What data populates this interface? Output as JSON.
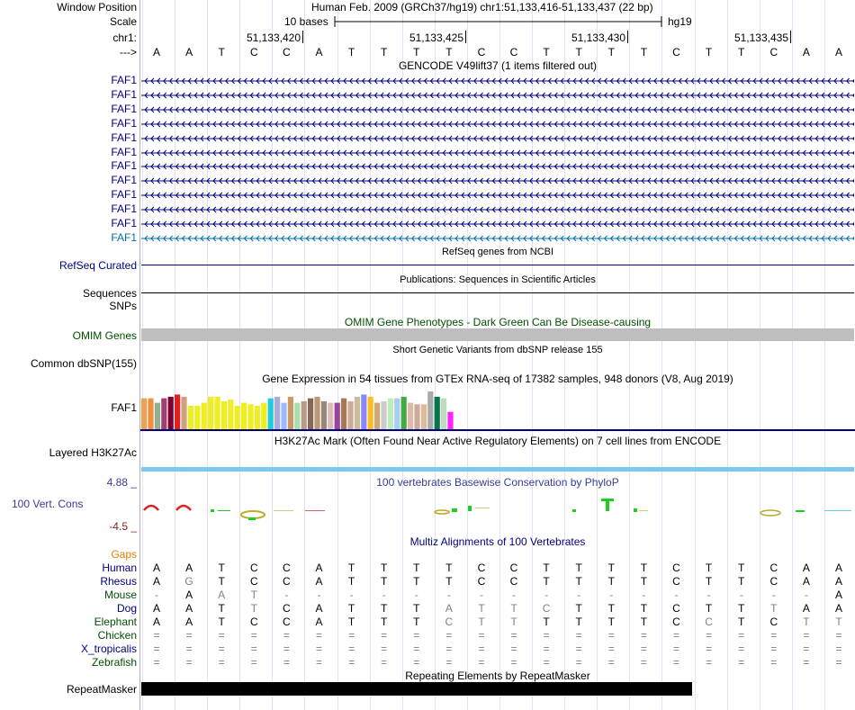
{
  "header": {
    "window_position_label": "Window Position",
    "window_position_value": "Human Feb. 2009 (GRCh37/hg19)   chr1:51,133,416-51,133,437 (22 bp)",
    "scale_label": "Scale",
    "scale_text": "10 bases",
    "assembly": "hg19",
    "chrom_label": "chr1:",
    "coord_labels": [
      "51,133,420",
      "51,133,425",
      "51,133,430",
      "51,133,435"
    ],
    "strand_label": "--->",
    "bases": [
      "A",
      "A",
      "T",
      "C",
      "C",
      "A",
      "T",
      "T",
      "T",
      "T",
      "C",
      "C",
      "T",
      "T",
      "T",
      "T",
      "C",
      "T",
      "T",
      "C",
      "A",
      "A"
    ]
  },
  "gencode": {
    "title": "GENCODE V49lift37 (1 items filtered out)",
    "genes": [
      "FAF1",
      "FAF1",
      "FAF1",
      "FAF1",
      "FAF1",
      "FAF1",
      "FAF1",
      "FAF1",
      "FAF1",
      "FAF1",
      "FAF1",
      "FAF1"
    ]
  },
  "refseq": {
    "title": "RefSeq genes from NCBI",
    "label": "RefSeq Curated"
  },
  "publications": {
    "title": "Publications: Sequences in Scientific Articles",
    "label": "Sequences"
  },
  "snps": {
    "label": "SNPs"
  },
  "omim": {
    "title": "OMIM Gene Phenotypes - Dark Green Can Be Disease-causing",
    "label": "OMIM Genes"
  },
  "dbsnp": {
    "title": "Short Genetic Variants from dbSNP release 155",
    "label": "Common dbSNP(155)"
  },
  "gtex": {
    "title": "Gene Expression in 54 tissues from GTEx RNA-seq of 17382 samples, 948 donors (V8, Aug 2019)",
    "label": "FAF1",
    "bars": [
      {
        "v": 0.82,
        "c": "#f0a050"
      },
      {
        "v": 0.82,
        "c": "#f09040"
      },
      {
        "v": 0.7,
        "c": "#90b090"
      },
      {
        "v": 0.82,
        "c": "#a04070"
      },
      {
        "v": 0.86,
        "c": "#800030"
      },
      {
        "v": 0.92,
        "c": "#e02020"
      },
      {
        "v": 0.86,
        "c": "#d0a080"
      },
      {
        "v": 0.62,
        "c": "#eeee22"
      },
      {
        "v": 0.62,
        "c": "#eeee22"
      },
      {
        "v": 0.7,
        "c": "#eeee22"
      },
      {
        "v": 0.86,
        "c": "#eeee22"
      },
      {
        "v": 0.86,
        "c": "#eeee22"
      },
      {
        "v": 0.74,
        "c": "#eeee22"
      },
      {
        "v": 0.78,
        "c": "#eeee22"
      },
      {
        "v": 0.62,
        "c": "#eeee22"
      },
      {
        "v": 0.7,
        "c": "#eeee22"
      },
      {
        "v": 0.66,
        "c": "#eeee22"
      },
      {
        "v": 0.62,
        "c": "#eeee22"
      },
      {
        "v": 0.7,
        "c": "#eeee22"
      },
      {
        "v": 0.82,
        "c": "#22ccdd"
      },
      {
        "v": 0.86,
        "c": "#aaaadd"
      },
      {
        "v": 0.7,
        "c": "#99bbff"
      },
      {
        "v": 0.86,
        "c": "#cc9966"
      },
      {
        "v": 0.7,
        "c": "#aaddaa"
      },
      {
        "v": 0.74,
        "c": "#bb9988"
      },
      {
        "v": 0.82,
        "c": "#886655"
      },
      {
        "v": 0.86,
        "c": "#bb9977"
      },
      {
        "v": 0.74,
        "c": "#998877"
      },
      {
        "v": 0.7,
        "c": "#ddbbbb"
      },
      {
        "v": 0.7,
        "c": "#994499"
      },
      {
        "v": 0.82,
        "c": "#aa7755"
      },
      {
        "v": 0.74,
        "c": "#ccaa99"
      },
      {
        "v": 0.86,
        "c": "#ccbb99"
      },
      {
        "v": 0.92,
        "c": "#8888ff"
      },
      {
        "v": 0.86,
        "c": "#ffbb22"
      },
      {
        "v": 0.7,
        "c": "#ccaa77"
      },
      {
        "v": 0.74,
        "c": "#cccccc"
      },
      {
        "v": 0.82,
        "c": "#bbeebb"
      },
      {
        "v": 0.82,
        "c": "#aaccee"
      },
      {
        "v": 0.86,
        "c": "#44aa44"
      },
      {
        "v": 0.7,
        "c": "#ddbbaa"
      },
      {
        "v": 0.66,
        "c": "#ccaa99"
      },
      {
        "v": 0.66,
        "c": "#ddbb99"
      },
      {
        "v": 1.0,
        "c": "#aaaaaa"
      },
      {
        "v": 0.86,
        "c": "#007744"
      },
      {
        "v": 0.82,
        "c": "#bbddbb"
      },
      {
        "v": 0.46,
        "c": "#ff22ff"
      }
    ]
  },
  "h3k27ac": {
    "title": "H3K27Ac Mark (Often Found Near Active Regulatory Elements) on 7 cell lines from ENCODE",
    "label": "Layered H3K27Ac"
  },
  "conservation": {
    "title": "100 vertebrates Basewise Conservation by PhyloP",
    "label": "100 Vert. Cons",
    "ymax_label": "4.88 _",
    "ymin_label": "-4.5 _"
  },
  "multiz": {
    "title": "Multiz Alignments of 100 Vertebrates",
    "gaps_label": "Gaps",
    "species": [
      {
        "name": "Human",
        "color": "#000080",
        "seq": [
          "A",
          "A",
          "T",
          "C",
          "C",
          "A",
          "T",
          "T",
          "T",
          "T",
          "C",
          "C",
          "T",
          "T",
          "T",
          "T",
          "C",
          "T",
          "T",
          "C",
          "A",
          "A"
        ]
      },
      {
        "name": "Rhesus",
        "color": "#000080",
        "seq": [
          "A",
          "G",
          "T",
          "C",
          "C",
          "A",
          "T",
          "T",
          "T",
          "T",
          "C",
          "C",
          "T",
          "T",
          "T",
          "T",
          "C",
          "T",
          "T",
          "C",
          "A",
          "A"
        ]
      },
      {
        "name": "Mouse",
        "color": "#005000",
        "seq": [
          "-",
          "A",
          "A",
          "T",
          "-",
          "-",
          "-",
          "-",
          "-",
          "-",
          "-",
          "-",
          "-",
          "-",
          "-",
          "-",
          "-",
          "-",
          "-",
          "-",
          "-",
          "A"
        ]
      },
      {
        "name": "Dog",
        "color": "#000080",
        "seq": [
          "A",
          "A",
          "T",
          "T",
          "C",
          "A",
          "T",
          "T",
          "T",
          "A",
          "T",
          "T",
          "C",
          "T",
          "T",
          "T",
          "C",
          "T",
          "T",
          "T",
          "A",
          "A"
        ]
      },
      {
        "name": "Elephant",
        "color": "#005000",
        "seq": [
          "A",
          "A",
          "T",
          "C",
          "C",
          "A",
          "T",
          "T",
          "T",
          "C",
          "T",
          "T",
          "T",
          "T",
          "T",
          "T",
          "C",
          "C",
          "T",
          "C",
          "T",
          "T"
        ]
      },
      {
        "name": "Chicken",
        "color": "#005000",
        "seq": [
          "=",
          "=",
          "=",
          "=",
          "=",
          "=",
          "=",
          "=",
          "=",
          "=",
          "=",
          "=",
          "=",
          "=",
          "=",
          "=",
          "=",
          "=",
          "=",
          "=",
          "=",
          "="
        ]
      },
      {
        "name": "X_tropicalis",
        "color": "#000080",
        "seq": [
          "=",
          "=",
          "=",
          "=",
          "=",
          "=",
          "=",
          "=",
          "=",
          "=",
          "=",
          "=",
          "=",
          "=",
          "=",
          "=",
          "=",
          "=",
          "=",
          "=",
          "=",
          "="
        ]
      },
      {
        "name": "Zebrafish",
        "color": "#005000",
        "seq": [
          "=",
          "=",
          "=",
          "=",
          "=",
          "=",
          "=",
          "=",
          "=",
          "=",
          "=",
          "=",
          "=",
          "=",
          "=",
          "=",
          "=",
          "=",
          "=",
          "=",
          "=",
          "="
        ]
      }
    ]
  },
  "repeatmasker": {
    "title": "Repeating Elements by RepeatMasker",
    "label": "RepeatMasker"
  },
  "colors": {
    "navy": "#000080",
    "teal_gene": "#0070a0",
    "omim_green": "#005000",
    "omim_gray": "#bebebe",
    "gaps_orange": "#e08000",
    "cons_blue": "#3a3a9a",
    "cons_red": "#8a2020",
    "h3k27ac": "#7cc8ee"
  }
}
